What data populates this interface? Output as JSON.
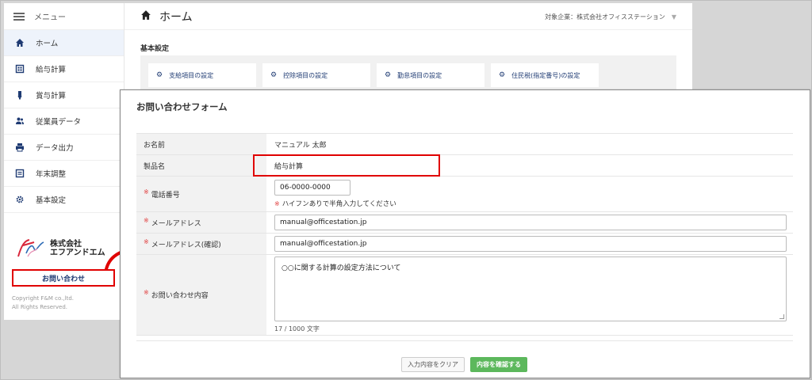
{
  "sidebar": {
    "menu_label": "メニュー",
    "items": [
      {
        "label": "ホーム",
        "icon": "home-icon"
      },
      {
        "label": "給与計算",
        "icon": "calculator-icon"
      },
      {
        "label": "賞与計算",
        "icon": "award-icon"
      },
      {
        "label": "従業員データ",
        "icon": "users-icon"
      },
      {
        "label": "データ出力",
        "icon": "printer-icon"
      },
      {
        "label": "年末調整",
        "icon": "calendar-icon"
      },
      {
        "label": "基本設定",
        "icon": "gear-icon"
      }
    ],
    "logo_line1": "株式会社",
    "logo_line2": "エフアンドエム",
    "contact_label": "お問い合わせ",
    "copyright_line1": "Copyright F&M co.,ltd.",
    "copyright_line2": "All Rights Reserved."
  },
  "header": {
    "title": "ホーム",
    "company_label": "対象企業：株式会社オフィスステーション"
  },
  "basic_settings": {
    "title": "基本設定",
    "cards": [
      {
        "label": "支給項目の設定"
      },
      {
        "label": "控除項目の設定"
      },
      {
        "label": "勤怠項目の設定"
      },
      {
        "label": "住民税(指定番号)の設定"
      }
    ]
  },
  "dialog": {
    "title": "お問い合わせフォーム",
    "required_mark": "※",
    "fields": {
      "name": {
        "label": "お名前",
        "value": "マニュアル 太郎"
      },
      "product": {
        "label": "製品名",
        "value": "給与計算"
      },
      "phone": {
        "label": "電話番号",
        "value": "06-0000-0000",
        "hint": "ハイフンありで半角入力してください"
      },
      "email": {
        "label": "メールアドレス",
        "value": "manual@officestation.jp"
      },
      "email_confirm": {
        "label": "メールアドレス(確認)",
        "value": "manual@officestation.jp"
      },
      "content": {
        "label": "お問い合わせ内容",
        "value": "○○に関する計算の設定方法について",
        "counter": "17 / 1000 文字"
      }
    },
    "clear_label": "入力内容をクリア",
    "confirm_label": "内容を確認する"
  },
  "colors": {
    "accent_red": "#e00000",
    "nav_blue": "#1f3b73",
    "confirm_green": "#5cb85c"
  }
}
